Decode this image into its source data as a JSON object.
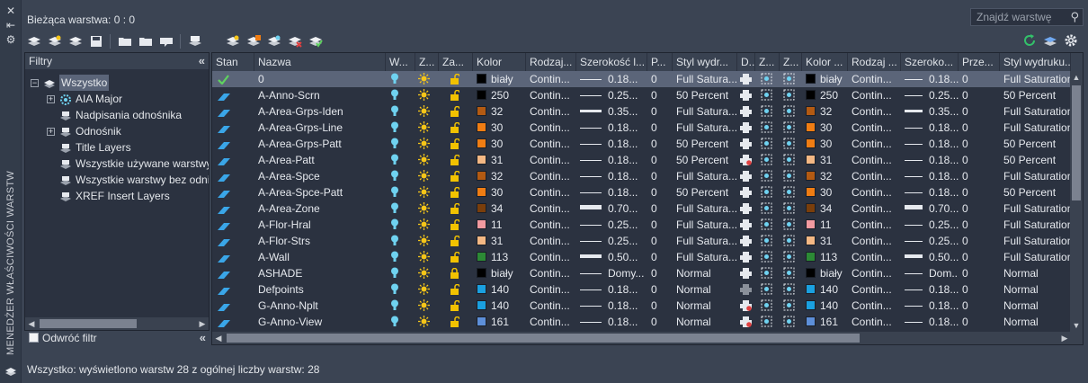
{
  "side": {
    "title": "MENEDŻER WŁAŚCIWOŚCI WARSTW"
  },
  "header": {
    "current_layer": "Bieżąca warstwa: 0 : 0",
    "search_placeholder": "Znajdź warstwę"
  },
  "filters": {
    "title": "Filtry",
    "tree": [
      {
        "label": "Wszystko",
        "level": 0,
        "expander": "−",
        "icon": "all-filter-icon",
        "selected": true
      },
      {
        "label": "AIA Major",
        "level": 1,
        "expander": "+",
        "icon": "group-filter-icon",
        "selected": false
      },
      {
        "label": "Nadpisania odnośnika",
        "level": 1,
        "expander": "",
        "icon": "property-filter-icon",
        "selected": false
      },
      {
        "label": "Odnośnik",
        "level": 1,
        "expander": "+",
        "icon": "property-filter-icon",
        "selected": false
      },
      {
        "label": "Title Layers",
        "level": 1,
        "expander": "",
        "icon": "property-filter-icon",
        "selected": false
      },
      {
        "label": "Wszystkie używane warstwy",
        "level": 1,
        "expander": "",
        "icon": "property-filter-icon",
        "selected": false
      },
      {
        "label": "Wszystkie warstwy bez odniesień",
        "level": 1,
        "expander": "",
        "icon": "property-filter-icon",
        "selected": false
      },
      {
        "label": "XREF Insert Layers",
        "level": 1,
        "expander": "",
        "icon": "property-filter-icon",
        "selected": false
      }
    ],
    "invert_label": "Odwróć filtr"
  },
  "columns": [
    {
      "key": "stan",
      "label": "Stan"
    },
    {
      "key": "name",
      "label": "Nazwa"
    },
    {
      "key": "on",
      "label": "W..."
    },
    {
      "key": "freeze",
      "label": "Z..."
    },
    {
      "key": "lock",
      "label": "Za..."
    },
    {
      "key": "color",
      "label": "Kolor"
    },
    {
      "key": "ltype",
      "label": "Rodzaj..."
    },
    {
      "key": "lweight",
      "label": "Szerokość l..."
    },
    {
      "key": "transp",
      "label": "P..."
    },
    {
      "key": "pstyle",
      "label": "Styl wydr..."
    },
    {
      "key": "plot",
      "label": "D..."
    },
    {
      "key": "vpfreeze",
      "label": "Z..."
    },
    {
      "key": "newvp",
      "label": "Z..."
    },
    {
      "key": "vpcolor",
      "label": "Kolor ..."
    },
    {
      "key": "vpltype",
      "label": "Rodzaj ..."
    },
    {
      "key": "vplweight",
      "label": "Szeroko..."
    },
    {
      "key": "vptransp",
      "label": "Prze..."
    },
    {
      "key": "vppstyle",
      "label": "Styl wydruku..."
    }
  ],
  "rows": [
    {
      "name": "0",
      "color": "biały",
      "color_hex": "#000000",
      "ltype": "Contin...",
      "lw": "0.18...",
      "lw_thick": 1,
      "transp": "0",
      "pstyle": "Full Satura...",
      "plot_no": false,
      "vpcolor": "biały",
      "vplw": "0.18...",
      "vpltype": "Contin...",
      "vptransp": "0",
      "vppstyle": "Full Saturation",
      "current": true,
      "lock_closed": false
    },
    {
      "name": "A-Anno-Scrn",
      "color": "250",
      "color_hex": "#000000",
      "ltype": "Contin...",
      "lw": "0.25...",
      "lw_thick": 1,
      "transp": "0",
      "pstyle": "50 Percent",
      "plot_no": false,
      "vpcolor": "250",
      "vplw": "0.25...",
      "vpltype": "Contin...",
      "vptransp": "0",
      "vppstyle": "50 Percent",
      "current": false,
      "lock_closed": false
    },
    {
      "name": "A-Area-Grps-Iden",
      "color": "32",
      "color_hex": "#b35a12",
      "ltype": "Contin...",
      "lw": "0.35...",
      "lw_thick": 3,
      "transp": "0",
      "pstyle": "Full Satura...",
      "plot_no": false,
      "vpcolor": "32",
      "vplw": "0.35...",
      "vpltype": "Contin...",
      "vptransp": "0",
      "vppstyle": "Full Saturation",
      "current": false,
      "lock_closed": false
    },
    {
      "name": "A-Area-Grps-Line",
      "color": "30",
      "color_hex": "#f07d13",
      "ltype": "Contin...",
      "lw": "0.18...",
      "lw_thick": 1,
      "transp": "0",
      "pstyle": "Full Satura...",
      "plot_no": false,
      "vpcolor": "30",
      "vplw": "0.18...",
      "vpltype": "Contin...",
      "vptransp": "0",
      "vppstyle": "Full Saturation",
      "current": false,
      "lock_closed": false
    },
    {
      "name": "A-Area-Grps-Patt",
      "color": "30",
      "color_hex": "#f07d13",
      "ltype": "Contin...",
      "lw": "0.18...",
      "lw_thick": 1,
      "transp": "0",
      "pstyle": "50 Percent",
      "plot_no": false,
      "vpcolor": "30",
      "vplw": "0.18...",
      "vpltype": "Contin...",
      "vptransp": "0",
      "vppstyle": "50 Percent",
      "current": false,
      "lock_closed": false
    },
    {
      "name": "A-Area-Patt",
      "color": "31",
      "color_hex": "#f4b884",
      "ltype": "Contin...",
      "lw": "0.18...",
      "lw_thick": 1,
      "transp": "0",
      "pstyle": "50 Percent",
      "plot_no": true,
      "vpcolor": "31",
      "vplw": "0.18...",
      "vpltype": "Contin...",
      "vptransp": "0",
      "vppstyle": "50 Percent",
      "current": false,
      "lock_closed": false
    },
    {
      "name": "A-Area-Spce",
      "color": "32",
      "color_hex": "#b35a12",
      "ltype": "Contin...",
      "lw": "0.18...",
      "lw_thick": 1,
      "transp": "0",
      "pstyle": "Full Satura...",
      "plot_no": false,
      "vpcolor": "32",
      "vplw": "0.18...",
      "vpltype": "Contin...",
      "vptransp": "0",
      "vppstyle": "Full Saturation",
      "current": false,
      "lock_closed": false
    },
    {
      "name": "A-Area-Spce-Patt",
      "color": "30",
      "color_hex": "#f07d13",
      "ltype": "Contin...",
      "lw": "0.18...",
      "lw_thick": 1,
      "transp": "0",
      "pstyle": "50 Percent",
      "plot_no": false,
      "vpcolor": "30",
      "vplw": "0.18...",
      "vpltype": "Contin...",
      "vptransp": "0",
      "vppstyle": "50 Percent",
      "current": false,
      "lock_closed": false
    },
    {
      "name": "A-Area-Zone",
      "color": "34",
      "color_hex": "#7a3e0b",
      "ltype": "Contin...",
      "lw": "0.70...",
      "lw_thick": 5,
      "transp": "0",
      "pstyle": "Full Satura...",
      "plot_no": false,
      "vpcolor": "34",
      "vplw": "0.70...",
      "vpltype": "Contin...",
      "vptransp": "0",
      "vppstyle": "Full Saturation",
      "current": false,
      "lock_closed": false
    },
    {
      "name": "A-Flor-Hral",
      "color": "11",
      "color_hex": "#f29aa0",
      "ltype": "Contin...",
      "lw": "0.25...",
      "lw_thick": 1,
      "transp": "0",
      "pstyle": "Full Satura...",
      "plot_no": false,
      "vpcolor": "11",
      "vplw": "0.25...",
      "vpltype": "Contin...",
      "vptransp": "0",
      "vppstyle": "Full Saturation",
      "current": false,
      "lock_closed": false
    },
    {
      "name": "A-Flor-Strs",
      "color": "31",
      "color_hex": "#f4b884",
      "ltype": "Contin...",
      "lw": "0.25...",
      "lw_thick": 1,
      "transp": "0",
      "pstyle": "Full Satura...",
      "plot_no": false,
      "vpcolor": "31",
      "vplw": "0.25...",
      "vpltype": "Contin...",
      "vptransp": "0",
      "vppstyle": "Full Saturation",
      "current": false,
      "lock_closed": false
    },
    {
      "name": "A-Wall",
      "color": "113",
      "color_hex": "#2c8a35",
      "ltype": "Contin...",
      "lw": "0.50...",
      "lw_thick": 4,
      "transp": "0",
      "pstyle": "Full Satura...",
      "plot_no": false,
      "vpcolor": "113",
      "vplw": "0.50...",
      "vpltype": "Contin...",
      "vptransp": "0",
      "vppstyle": "Full Saturation",
      "current": false,
      "lock_closed": false
    },
    {
      "name": "ASHADE",
      "color": "biały",
      "color_hex": "#000000",
      "ltype": "Contin...",
      "lw": "Domy...",
      "lw_thick": 1,
      "transp": "0",
      "pstyle": "Normal",
      "plot_no": false,
      "vpcolor": "biały",
      "vplw": "Dom...",
      "vpltype": "Contin...",
      "vptransp": "0",
      "vppstyle": "Normal",
      "current": false,
      "lock_closed": true
    },
    {
      "name": "Defpoints",
      "color": "140",
      "color_hex": "#1aa0e0",
      "ltype": "Contin...",
      "lw": "0.18...",
      "lw_thick": 1,
      "transp": "0",
      "pstyle": "Normal",
      "plot_no": false,
      "plot_grey": true,
      "vpcolor": "140",
      "vplw": "0.18...",
      "vpltype": "Contin...",
      "vptransp": "0",
      "vppstyle": "Normal",
      "current": false,
      "lock_closed": false
    },
    {
      "name": "G-Anno-Nplt",
      "color": "140",
      "color_hex": "#1aa0e0",
      "ltype": "Contin...",
      "lw": "0.18...",
      "lw_thick": 1,
      "transp": "0",
      "pstyle": "Normal",
      "plot_no": true,
      "vpcolor": "140",
      "vplw": "0.18...",
      "vpltype": "Contin...",
      "vptransp": "0",
      "vppstyle": "Normal",
      "current": false,
      "lock_closed": false
    },
    {
      "name": "G-Anno-View",
      "color": "161",
      "color_hex": "#5d8fd9",
      "ltype": "Contin...",
      "lw": "0.18...",
      "lw_thick": 1,
      "transp": "0",
      "pstyle": "Normal",
      "plot_no": true,
      "vpcolor": "161",
      "vplw": "0.18...",
      "vpltype": "Contin...",
      "vptransp": "0",
      "vppstyle": "Normal",
      "current": false,
      "lock_closed": false
    }
  ],
  "status": "Wszystko: wyświetlono warstw 28 z ogólnej liczby warstw: 28",
  "colors": {
    "bulb": "#6fd2f0",
    "sun": "#f5c518",
    "lock": "#f2c200",
    "current_check": "#5fd35f",
    "layer_icon": "#3aa6e8",
    "refresh": "#33c16a"
  },
  "toolbar_icons": [
    "new-property-filter-icon",
    "new-group-filter-icon",
    "layer-states-icon",
    "new-layer-icon",
    "new-layer-vp-frozen-icon",
    "delete-layer-icon",
    "set-current-icon",
    "settings-icon",
    "refresh-icon"
  ]
}
